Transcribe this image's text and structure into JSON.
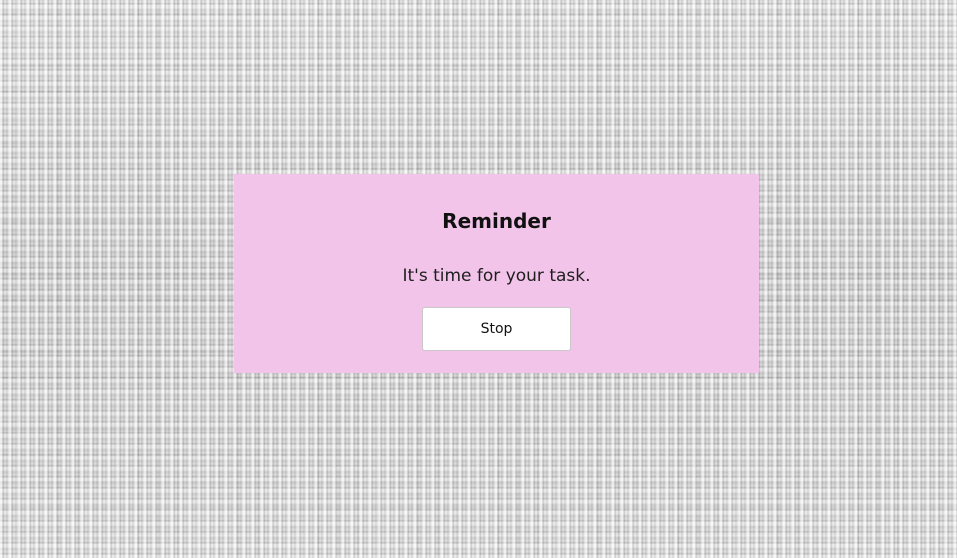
{
  "dialog": {
    "title": "Reminder",
    "message": "It's time for your task.",
    "stop_label": "Stop",
    "background_color": "#f3c4ea"
  }
}
